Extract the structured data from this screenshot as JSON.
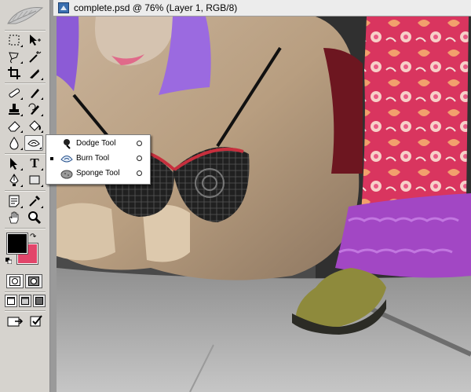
{
  "document": {
    "title": "complete.psd @ 76% (Layer 1, RGB/8)"
  },
  "toolbox": {
    "tools": [
      {
        "name": "rectangular-marquee-tool"
      },
      {
        "name": "move-tool"
      },
      {
        "name": "lasso-tool"
      },
      {
        "name": "magic-wand-tool"
      },
      {
        "name": "crop-tool"
      },
      {
        "name": "slice-tool"
      },
      {
        "name": "healing-brush-tool"
      },
      {
        "name": "brush-tool"
      },
      {
        "name": "clone-stamp-tool"
      },
      {
        "name": "history-brush-tool"
      },
      {
        "name": "eraser-tool"
      },
      {
        "name": "paint-bucket-tool"
      },
      {
        "name": "blur-tool"
      },
      {
        "name": "burn-tool",
        "active": true
      },
      {
        "name": "path-selection-tool"
      },
      {
        "name": "type-tool",
        "label": "T"
      },
      {
        "name": "pen-tool"
      },
      {
        "name": "rectangle-shape-tool"
      },
      {
        "name": "notes-tool"
      },
      {
        "name": "eyedropper-tool"
      },
      {
        "name": "hand-tool"
      },
      {
        "name": "zoom-tool"
      }
    ],
    "foreground_color": "#000000",
    "background_color": "#e2456a"
  },
  "flyout": {
    "items": [
      {
        "label": "Dodge Tool",
        "icon": "dodge-icon",
        "selected": false
      },
      {
        "label": "Burn Tool",
        "icon": "burn-icon",
        "selected": true
      },
      {
        "label": "Sponge Tool",
        "icon": "sponge-icon",
        "selected": false
      }
    ]
  }
}
